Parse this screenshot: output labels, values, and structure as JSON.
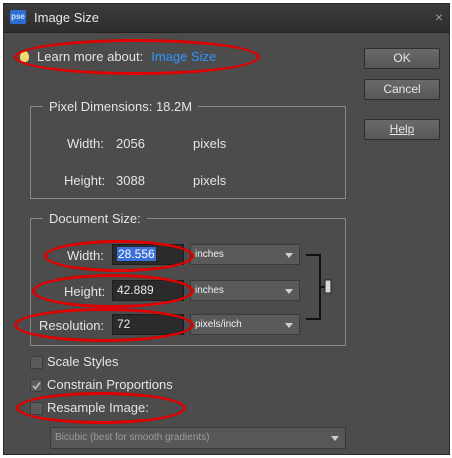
{
  "window": {
    "title": "Image Size",
    "app_icon": "pse"
  },
  "learn": {
    "prefix": "Learn more about:",
    "link": "Image Size"
  },
  "buttons": {
    "ok": "OK",
    "cancel": "Cancel",
    "help": "Help"
  },
  "pixel_dimensions": {
    "label": "Pixel Dimensions:",
    "value": "18.2M",
    "width_label": "Width:",
    "width": "2056",
    "width_unit": "pixels",
    "height_label": "Height:",
    "height": "3088",
    "height_unit": "pixels"
  },
  "document_size": {
    "label": "Document Size:",
    "width_label": "Width:",
    "width": "28.556",
    "width_unit": "inches",
    "height_label": "Height:",
    "height": "42.889",
    "height_unit": "inches",
    "resolution_label": "Resolution:",
    "resolution": "72",
    "resolution_unit": "pixels/inch"
  },
  "options": {
    "scale_styles": "Scale Styles",
    "constrain": "Constrain Proportions",
    "resample": "Resample Image:",
    "resample_method": "Bicubic (best for smooth gradients)"
  },
  "colors": {
    "annotation": "#e00000",
    "link": "#2f96ff",
    "dialog_bg": "#4c4c4c"
  }
}
